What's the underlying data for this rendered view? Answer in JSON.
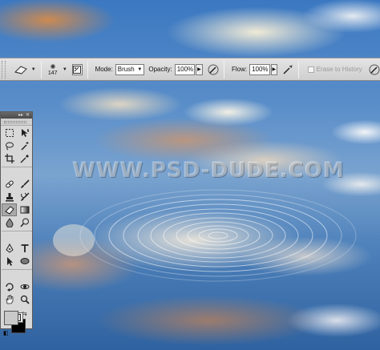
{
  "watermark": "WWW.PSD-DUDE.COM",
  "options_bar": {
    "brush_size": "147",
    "mode_label": "Mode:",
    "mode_value": "Brush",
    "opacity_label": "Opacity:",
    "opacity_value": "100%",
    "flow_label": "Flow:",
    "flow_value": "100%",
    "erase_to_history_label": "Erase to History",
    "erase_to_history_checked": false
  },
  "tools_panel": {
    "header_icons": [
      "expand-arrows-icon",
      "close-icon"
    ],
    "tools": [
      "rectangular-marquee-icon",
      "move-icon",
      "lasso-icon",
      "magic-wand-icon",
      "crop-icon",
      "eyedropper-icon",
      "spot-healing-brush-icon",
      "brush-icon",
      "clone-stamp-icon",
      "history-brush-icon",
      "eraser-icon",
      "gradient-icon",
      "blur-icon",
      "dodge-icon",
      "pen-icon",
      "type-icon",
      "path-selection-icon",
      "ellipse-shape-icon",
      "3d-rotate-icon",
      "3d-orbit-icon",
      "hand-icon",
      "zoom-icon"
    ],
    "active_tool": "eraser-icon",
    "foreground_color": "#c9c9c9",
    "background_color": "#000000"
  }
}
